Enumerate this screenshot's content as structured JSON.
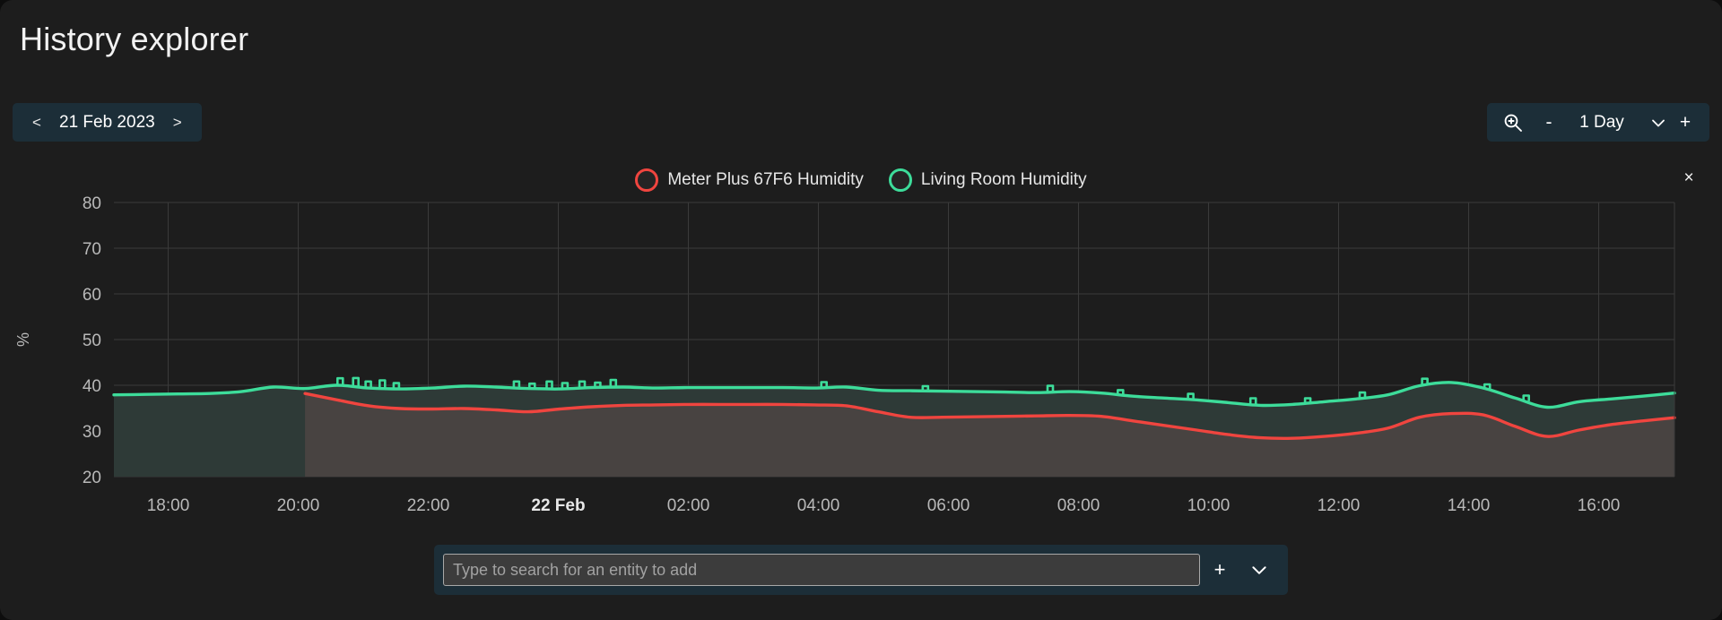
{
  "header": {
    "title": "History explorer"
  },
  "date_picker": {
    "prev_label": "<",
    "next_label": ">",
    "date": "21 Feb 2023"
  },
  "zoom_controls": {
    "magnifier_icon": "zoom-in-icon",
    "minus_label": "-",
    "value": "1 Day",
    "chevron_icon": "chevron-down-icon",
    "plus_label": "+"
  },
  "chart_close": {
    "label": "×"
  },
  "entity_search": {
    "placeholder": "Type to search for an entity to add",
    "value": "",
    "add_label": "+",
    "chevron_label": "⌄"
  },
  "colors": {
    "page_bg": "#1d1d1d",
    "panel_bg": "#1c2e38",
    "series_red": "#f0453f",
    "series_green": "#3ddc9a",
    "fill_green": "#2e3a37",
    "fill_red": "#4b4442",
    "grid": "#3a3a3a",
    "axis_text": "#b9b9b9"
  },
  "chart_data": {
    "type": "line",
    "title": "",
    "xlabel": "",
    "ylabel": "%",
    "ylim": [
      20,
      80
    ],
    "yticks": [
      20,
      30,
      40,
      50,
      60,
      70,
      80
    ],
    "grid": true,
    "legend_position": "top-center",
    "filled": true,
    "xticks": [
      "18:00",
      "20:00",
      "22:00",
      "22 Feb",
      "02:00",
      "04:00",
      "06:00",
      "08:00",
      "10:00",
      "12:00",
      "14:00",
      "16:00"
    ],
    "xtick_bold": [
      "22 Feb"
    ],
    "x": [
      "17:00",
      "17:30",
      "18:00",
      "18:30",
      "19:00",
      "19:15",
      "19:30",
      "19:45",
      "20:00",
      "20:30",
      "21:00",
      "21:30",
      "22:00",
      "22:30",
      "23:00",
      "23:30",
      "00:00",
      "00:30",
      "01:00",
      "02:00",
      "03:00",
      "04:00",
      "05:00",
      "05:45",
      "06:00",
      "06:30",
      "07:00",
      "07:30",
      "08:00",
      "08:30",
      "09:00",
      "09:30",
      "10:00",
      "10:30",
      "11:00",
      "11:30",
      "12:00",
      "12:30",
      "13:00",
      "13:30",
      "14:00",
      "14:30",
      "14:45",
      "15:00",
      "15:15",
      "15:30",
      "15:45",
      "16:00",
      "16:30",
      "17:00"
    ],
    "series": [
      {
        "name": "Living Room Humidity",
        "color": "#3ddc9a",
        "unit": "%",
        "values": [
          37.9,
          38.0,
          38.1,
          38.2,
          38.6,
          39.6,
          39.3,
          40.0,
          39.4,
          39.2,
          39.4,
          39.8,
          39.6,
          39.3,
          39.2,
          39.5,
          39.6,
          39.4,
          39.5,
          39.5,
          39.5,
          39.5,
          39.4,
          39.6,
          38.9,
          38.8,
          38.7,
          38.6,
          38.5,
          38.4,
          38.6,
          38.3,
          37.6,
          37.2,
          36.8,
          36.2,
          35.6,
          35.8,
          36.4,
          37.0,
          37.9,
          39.9,
          40.6,
          39.4,
          37.2,
          35.2,
          36.4,
          37.0,
          37.6,
          38.3
        ]
      },
      {
        "name": "Meter Plus 67F6 Humidity",
        "color": "#f0453f",
        "unit": "%",
        "start_index": 6,
        "values": [
          null,
          null,
          null,
          null,
          null,
          null,
          38.2,
          36.8,
          35.5,
          34.9,
          34.8,
          34.9,
          34.6,
          34.2,
          34.8,
          35.3,
          35.6,
          35.7,
          35.8,
          35.8,
          35.8,
          35.8,
          35.7,
          35.5,
          34.2,
          33.0,
          33.0,
          33.1,
          33.2,
          33.3,
          33.4,
          33.2,
          32.2,
          31.2,
          30.2,
          29.2,
          28.5,
          28.4,
          28.8,
          29.5,
          30.6,
          33.0,
          33.8,
          33.5,
          31.0,
          28.8,
          30.2,
          31.4,
          32.2,
          32.9
        ]
      }
    ]
  }
}
